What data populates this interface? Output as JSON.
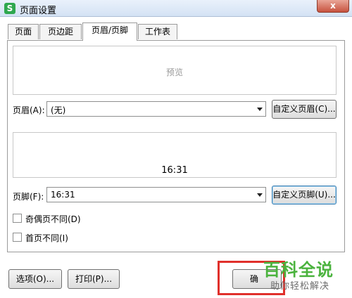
{
  "window": {
    "title": "页面设置",
    "app_icon_letter": "S",
    "close_glyph": "x"
  },
  "tabs": [
    {
      "label": "页面"
    },
    {
      "label": "页边距"
    },
    {
      "label": "页眉/页脚"
    },
    {
      "label": "工作表"
    }
  ],
  "active_tab": "页眉/页脚",
  "header_preview": {
    "text": "预览"
  },
  "header": {
    "label": "页眉(A):",
    "value": "(无)",
    "custom_button": "自定义页眉(C)..."
  },
  "footer_preview": {
    "text": "16:31"
  },
  "footer": {
    "label": "页脚(F):",
    "value": "16:31",
    "custom_button": "自定义页脚(U)..."
  },
  "options": {
    "odd_even": {
      "label": "奇偶页不同(D)",
      "checked": false
    },
    "first_page": {
      "label": "首页不同(I)",
      "checked": false
    }
  },
  "bottom_buttons": {
    "options": "选项(O)...",
    "print": "打印(P)...",
    "ok_partial": "确"
  },
  "watermark": {
    "main": "百科全说",
    "sub": "助你轻松解决"
  },
  "colors": {
    "highlight_box": "#e0302b",
    "watermark_green": "#4bb33e"
  }
}
